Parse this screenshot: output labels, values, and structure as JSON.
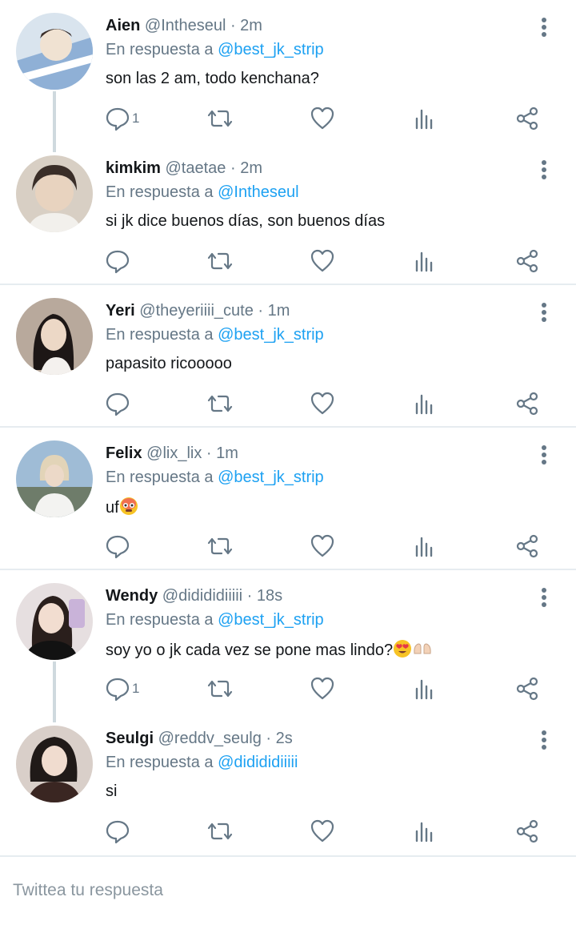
{
  "reply_prefix": "En respuesta a",
  "tweets": [
    {
      "name": "Aien",
      "handle": "@Intheseul",
      "time": "2m",
      "reply_to": "@best_jk_strip",
      "text": "son las 2 am, todo kenchana?",
      "reply_count": "1",
      "avatar_colors": [
        "#8fb0d6",
        "#f0e2d2"
      ]
    },
    {
      "name": "kimkim",
      "handle": "@taetae",
      "time": "2m",
      "reply_to": "@Intheseul",
      "text": "si jk dice buenos días, son buenos días",
      "reply_count": "",
      "avatar_colors": [
        "#d8cfc4",
        "#3a2e28"
      ]
    },
    {
      "name": "Yeri",
      "handle": "@theyeriiii_cute",
      "time": "1m",
      "reply_to": "@best_jk_strip",
      "text": "papasito ricooooo",
      "reply_count": "",
      "avatar_colors": [
        "#b8a99c",
        "#1d1716"
      ]
    },
    {
      "name": "Felix",
      "handle": "@lix_lix",
      "time": "1m",
      "reply_to": "@best_jk_strip",
      "text": "uf",
      "reply_count": "",
      "avatar_colors": [
        "#7fa1c4",
        "#e8dccb"
      ]
    },
    {
      "name": "Wendy",
      "handle": "@didididiiiii",
      "time": "18s",
      "reply_to": "@best_jk_strip",
      "text": "soy yo o jk cada vez se pone mas lindo?",
      "reply_count": "1",
      "avatar_colors": [
        "#c9b3d9",
        "#2a1f1c"
      ]
    },
    {
      "name": "Seulgi",
      "handle": "@reddv_seulg",
      "time": "2s",
      "reply_to": "@didididiiiii",
      "text": "si",
      "reply_count": "",
      "avatar_colors": [
        "#d9cfc9",
        "#201a18"
      ]
    }
  ],
  "reply_bar": {
    "placeholder": "Twittea tu respuesta"
  },
  "colors": {
    "mention": "#1da1f2",
    "secondary_text": "#657786",
    "divider": "#e6ecf0"
  }
}
